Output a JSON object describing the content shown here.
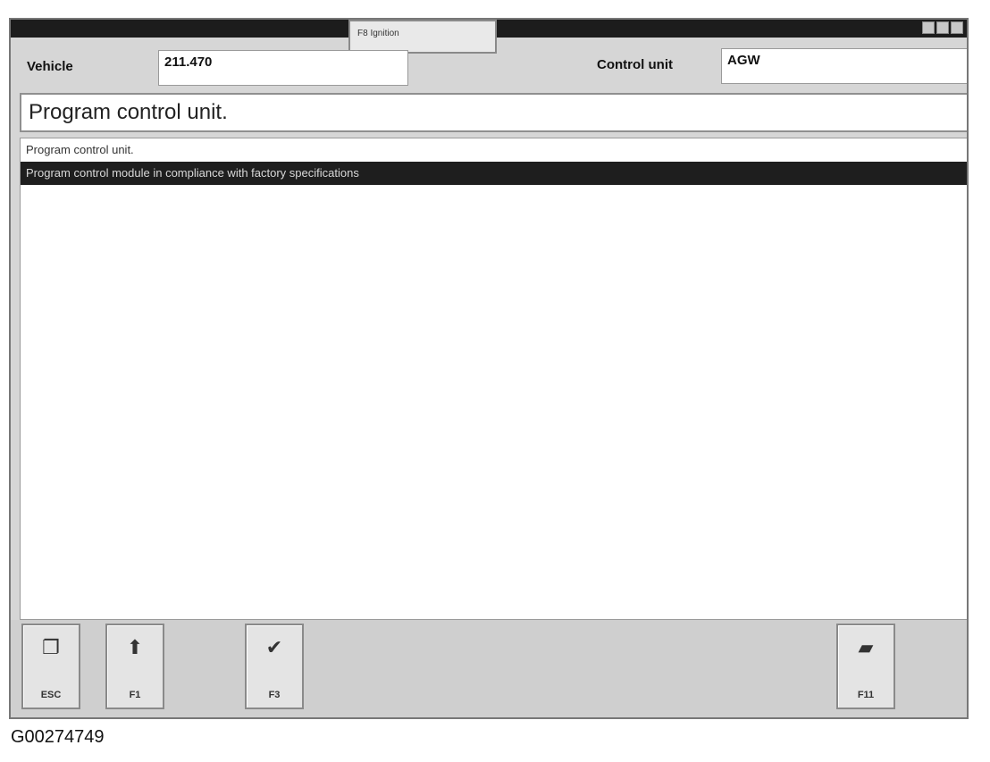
{
  "popup": {
    "label": "F8 Ignition"
  },
  "header": {
    "vehicle_label": "Vehicle",
    "vehicle_value": "211.470",
    "control_unit_label": "Control unit",
    "control_unit_value": "AGW"
  },
  "heading": "Program control unit.",
  "list": {
    "items": [
      {
        "label": "Program control unit."
      },
      {
        "label": "Program control module in compliance with factory specifications"
      }
    ],
    "selected_index": 1
  },
  "toolbar": {
    "buttons": [
      {
        "key": "ESC",
        "icon": "exit-door-icon"
      },
      {
        "key": "F1",
        "icon": "up-arrow-icon"
      },
      {
        "key": "F3",
        "icon": "checkmark-icon"
      },
      {
        "key": "F11",
        "icon": "eraser-icon"
      }
    ]
  },
  "caption": "G00274749"
}
